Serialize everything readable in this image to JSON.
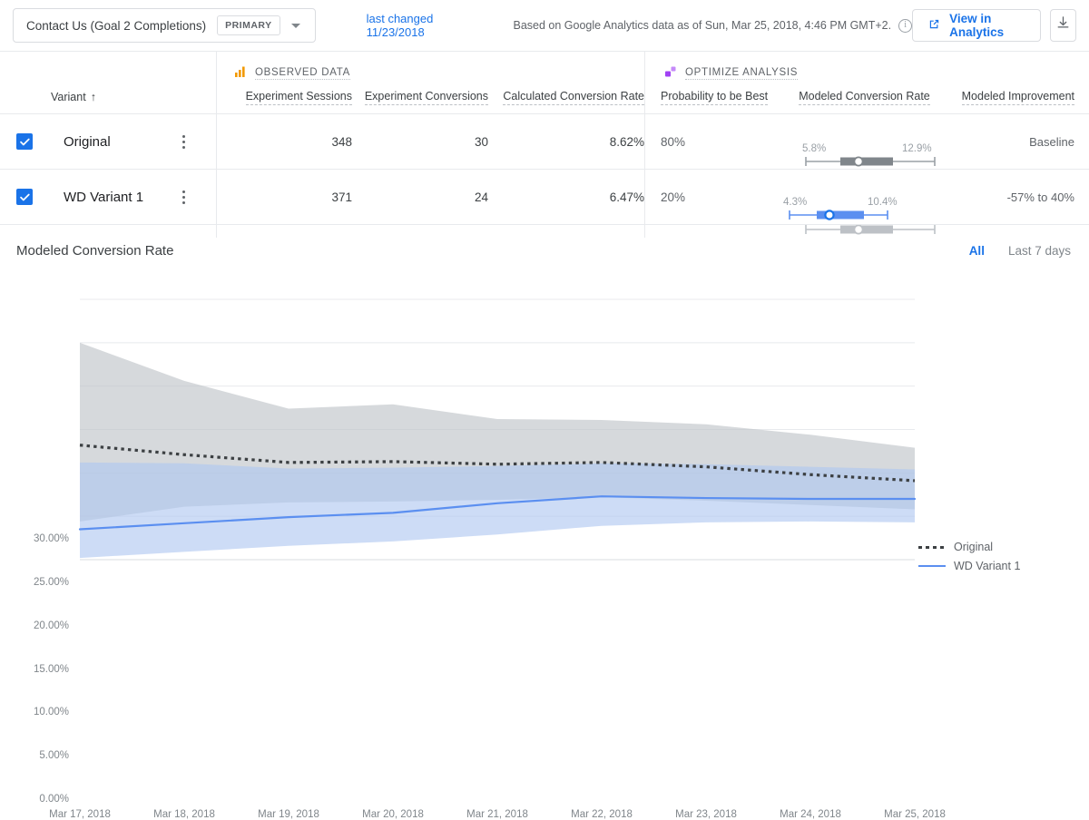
{
  "topbar": {
    "goal_name": "Contact Us (Goal 2 Completions)",
    "primary_chip": "PRIMARY",
    "caret_icon": "chevron-down-icon",
    "last_changed": "last changed 11/23/2018",
    "based_on": "Based on Google Analytics data as of Sun, Mar 25, 2018, 4:46 PM GMT+2.",
    "info_icon": "i",
    "view_in_analytics": "View in Analytics",
    "open_external_icon": "open-in-new-icon",
    "download_icon": "download-icon"
  },
  "table": {
    "groups": {
      "observed": "OBSERVED DATA",
      "optimize": "OPTIMIZE ANALYSIS"
    },
    "headers": {
      "variant": "Variant",
      "sort_arrow": "↑",
      "sessions": "Experiment Sessions",
      "conversions": "Experiment Conversions",
      "calculated_rate": "Calculated Conversion Rate",
      "probability": "Probability to be Best",
      "modeled_rate": "Modeled Conversion Rate",
      "modeled_improvement": "Modeled Improvement"
    },
    "rows": [
      {
        "name": "Original",
        "checked": true,
        "sessions": "348",
        "conversions": "30",
        "calculated_rate": "8.62%",
        "probability": "80%",
        "ci_low": "5.8%",
        "ci_high": "12.9%",
        "improvement": "Baseline"
      },
      {
        "name": "WD Variant 1",
        "checked": true,
        "sessions": "371",
        "conversions": "24",
        "calculated_rate": "6.47%",
        "probability": "20%",
        "ci_low": "4.3%",
        "ci_high": "10.4%",
        "improvement": "-57% to 40%"
      }
    ]
  },
  "chart_panel": {
    "title": "Modeled Conversion Rate",
    "range_tabs": [
      {
        "label": "All",
        "active": true
      },
      {
        "label": "Last 7 days",
        "active": false
      }
    ]
  },
  "colors": {
    "accent_blue": "#1a73e8",
    "series_variant": "#5b8ff0",
    "series_original": "#3c4043",
    "band_original": "#bdc1c6",
    "band_variant": "#aec6f0",
    "grid": "#e8eaed",
    "text_muted": "#80868b",
    "observed_icon": "#f29900",
    "optimize_icon": "#a142f4"
  },
  "chart_data": {
    "type": "area",
    "title": "Modeled Conversion Rate",
    "xlabel": "",
    "ylabel": "",
    "ylim": [
      0,
      30
    ],
    "ytick_labels": [
      "0.00%",
      "5.00%",
      "10.00%",
      "15.00%",
      "20.00%",
      "25.00%",
      "30.00%"
    ],
    "ytick_values": [
      0,
      5,
      10,
      15,
      20,
      25,
      30
    ],
    "grid": true,
    "legend_position": "right",
    "x": [
      "Mar 17, 2018",
      "Mar 18, 2018",
      "Mar 19, 2018",
      "Mar 20, 2018",
      "Mar 21, 2018",
      "Mar 22, 2018",
      "Mar 23, 2018",
      "Mar 24, 2018",
      "Mar 25, 2018"
    ],
    "series": [
      {
        "name": "Original",
        "style": "dotted",
        "color": "#3c4043",
        "values": [
          13.2,
          12.1,
          11.2,
          11.3,
          11.0,
          11.2,
          10.7,
          9.8,
          9.1
        ],
        "band_upper": [
          25.0,
          20.6,
          17.4,
          17.9,
          16.2,
          16.1,
          15.6,
          14.4,
          12.9
        ],
        "band_lower": [
          4.4,
          6.1,
          6.6,
          6.7,
          6.9,
          7.2,
          6.8,
          6.3,
          5.8
        ],
        "band_color": "#bdc1c6"
      },
      {
        "name": "WD Variant 1",
        "style": "solid",
        "color": "#5b8ff0",
        "values": [
          3.5,
          4.2,
          4.9,
          5.4,
          6.5,
          7.3,
          7.1,
          7.0,
          7.0
        ],
        "band_upper": [
          11.2,
          11.1,
          10.5,
          10.6,
          10.8,
          11.1,
          11.0,
          10.7,
          10.4
        ],
        "band_lower": [
          0.2,
          0.9,
          1.6,
          2.1,
          2.9,
          3.9,
          4.3,
          4.4,
          4.3
        ],
        "band_color": "#aec6f0"
      }
    ]
  }
}
